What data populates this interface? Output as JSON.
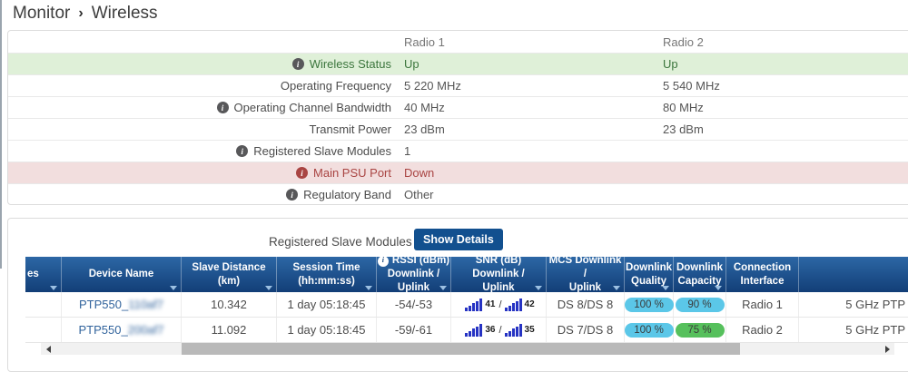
{
  "breadcrumb": {
    "section": "Monitor",
    "separator": "›",
    "page": "Wireless"
  },
  "status_table": {
    "columns": {
      "radio1": "Radio 1",
      "radio2": "Radio 2"
    },
    "rows": [
      {
        "label": "Wireless Status",
        "info": true,
        "radio1": "Up",
        "radio2": "Up",
        "state": "success"
      },
      {
        "label": "Operating Frequency",
        "info": false,
        "radio1": "5 220 MHz",
        "radio2": "5 540 MHz",
        "state": "normal"
      },
      {
        "label": "Operating Channel Bandwidth",
        "info": true,
        "radio1": "40 MHz",
        "radio2": "80 MHz",
        "state": "normal"
      },
      {
        "label": "Transmit Power",
        "info": false,
        "radio1": "23 dBm",
        "radio2": "23 dBm",
        "state": "normal"
      },
      {
        "label": "Registered Slave Modules",
        "info": true,
        "radio1": "1",
        "radio2": "",
        "state": "normal"
      },
      {
        "label": "Main PSU Port",
        "info": true,
        "radio1": "Down",
        "radio2": "",
        "state": "danger"
      },
      {
        "label": "Regulatory Band",
        "info": true,
        "radio1": "Other",
        "radio2": "",
        "state": "normal"
      }
    ]
  },
  "slave_section": {
    "title": "Registered Slave Modules",
    "show_details_label": "Show Details",
    "table": {
      "snr_separator": "/",
      "headers": [
        {
          "line1": "es",
          "line2": ""
        },
        {
          "line1": "Device Name",
          "line2": ""
        },
        {
          "line1": "Slave Distance (km)",
          "line2": ""
        },
        {
          "line1": "Session Time",
          "line2": "(hh:mm:ss)"
        },
        {
          "line1": "RSSI (dBm)",
          "line2": "Downlink / Uplink",
          "info": true
        },
        {
          "line1": "SNR (dB) Downlink /",
          "line2": "Uplink"
        },
        {
          "line1": "MCS Downlink /",
          "line2": "Uplink"
        },
        {
          "line1": "Downlink",
          "line2": "Quality"
        },
        {
          "line1": "Downlink",
          "line2": "Capacity"
        },
        {
          "line1": "Connection",
          "line2": "Interface"
        },
        {
          "line1": "",
          "line2": ""
        }
      ],
      "rows": [
        {
          "device_prefix": "PTP550_",
          "device_redacted": "110af7",
          "distance": "10.342",
          "session": "1 day 05:18:45",
          "rssi": "-54/-53",
          "snr_downlink": "41",
          "snr_uplink": "42",
          "mcs": "DS 8/DS 8",
          "quality": "100 %",
          "capacity": "90 %",
          "interface": "Radio 1",
          "mode": "5 GHz PTP"
        },
        {
          "device_prefix": "PTP550_",
          "device_redacted": "200af7",
          "distance": "11.092",
          "session": "1 day 05:18:45",
          "rssi": "-59/-61",
          "snr_downlink": "36",
          "snr_uplink": "35",
          "mcs": "DS 7/DS 8",
          "quality": "100 %",
          "capacity": "75 %",
          "interface": "Radio 2",
          "mode": "5 GHz PTP"
        }
      ]
    }
  },
  "colors": {
    "header_blue_top": "#2c67a5",
    "header_blue_bottom": "#123e77",
    "button_blue": "#12508f",
    "pill_blue": "#5bc7e8",
    "pill_green": "#56c05c",
    "success_bg": "#dff0d8",
    "success_text": "#3c763d",
    "danger_bg": "#f2dede",
    "danger_text": "#a94442",
    "link_blue": "#31639c",
    "signal_bar_blue": "#2633c3"
  }
}
